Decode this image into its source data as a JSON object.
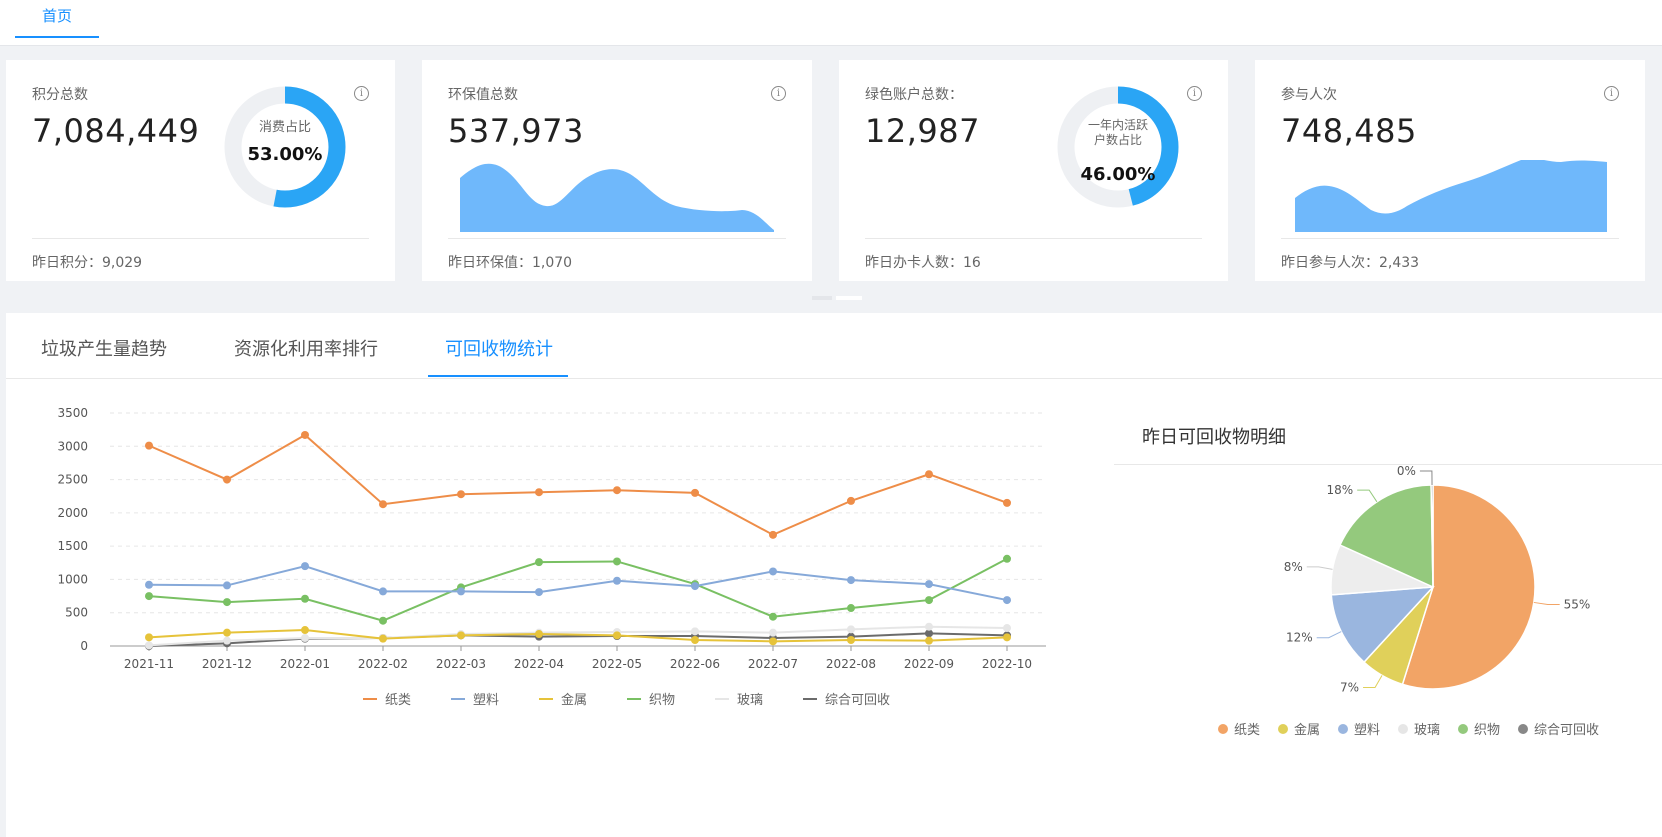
{
  "topbar": {
    "home_tab": "首页"
  },
  "cards": [
    {
      "label": "积分总数",
      "value": "7,084,449",
      "donut_caption": "消费占比",
      "donut_pct": "53.00%",
      "donut_fraction": 0.53,
      "footer": "昨日积分：9,029"
    },
    {
      "label": "环保值总数",
      "value": "537,973",
      "footer": "昨日环保值：1,070"
    },
    {
      "label": "绿色账户总数：",
      "value": "12,987",
      "donut_caption": "一年内活跃户数占比",
      "donut_pct": "46.00%",
      "donut_fraction": 0.46,
      "footer": "昨日办卡人数：16"
    },
    {
      "label": "参与人次",
      "value": "748,485",
      "footer": "昨日参与人次：2,433"
    }
  ],
  "colors": {
    "accent": "#1890ff",
    "donut": "#2aa5f5",
    "area": "#6fb8fb",
    "track": "#eef0f3"
  },
  "tabs": [
    "垃圾产生量趋势",
    "资源化利用率排行",
    "可回收物统计"
  ],
  "active_tab": 2,
  "side_title": "昨日可回收物明细",
  "chart_data": [
    {
      "type": "line",
      "x": [
        "2021-11",
        "2021-12",
        "2022-01",
        "2022-02",
        "2022-03",
        "2022-04",
        "2022-05",
        "2022-06",
        "2022-07",
        "2022-08",
        "2022-09",
        "2022-10"
      ],
      "ylim": [
        0,
        3500
      ],
      "yticks": [
        0,
        500,
        1000,
        1500,
        2000,
        2500,
        3000,
        3500
      ],
      "grid": true,
      "legend": "bottom",
      "series": [
        {
          "name": "纸类",
          "color": "#ee8d48",
          "values": [
            3010,
            2500,
            3170,
            2130,
            2280,
            2310,
            2340,
            2300,
            1670,
            2180,
            2580,
            2150
          ]
        },
        {
          "name": "塑料",
          "color": "#86a9d9",
          "values": [
            920,
            910,
            1200,
            820,
            820,
            810,
            980,
            900,
            1120,
            990,
            930,
            690
          ]
        },
        {
          "name": "金属",
          "color": "#e6c33a",
          "values": [
            130,
            200,
            240,
            110,
            160,
            180,
            160,
            90,
            70,
            90,
            80,
            130
          ]
        },
        {
          "name": "织物",
          "color": "#79c063",
          "values": [
            750,
            660,
            710,
            380,
            880,
            1260,
            1270,
            930,
            440,
            570,
            690,
            1310
          ]
        },
        {
          "name": "玻璃",
          "color": "#e6e6e6",
          "values": [
            10,
            80,
            120,
            120,
            180,
            200,
            210,
            220,
            200,
            250,
            290,
            270
          ]
        },
        {
          "name": "综合可回收",
          "color": "#6b6b6b",
          "values": [
            0,
            40,
            110,
            120,
            160,
            140,
            150,
            150,
            120,
            140,
            190,
            160
          ]
        }
      ]
    },
    {
      "type": "pie",
      "legend": "bottom",
      "slices": [
        {
          "name": "纸类",
          "value": 55,
          "label": "55%",
          "color": "#f2a466"
        },
        {
          "name": "金属",
          "value": 7,
          "label": "7%",
          "color": "#e0d05a"
        },
        {
          "name": "塑料",
          "value": 12,
          "label": "12%",
          "color": "#9ab6df"
        },
        {
          "name": "玻璃",
          "value": 8,
          "label": "8%",
          "color": "#ededed"
        },
        {
          "name": "织物",
          "value": 18,
          "label": "18%",
          "color": "#94c97d"
        },
        {
          "name": "综合可回收",
          "value": 0.3,
          "label": "0%",
          "color": "#888888"
        }
      ]
    }
  ]
}
